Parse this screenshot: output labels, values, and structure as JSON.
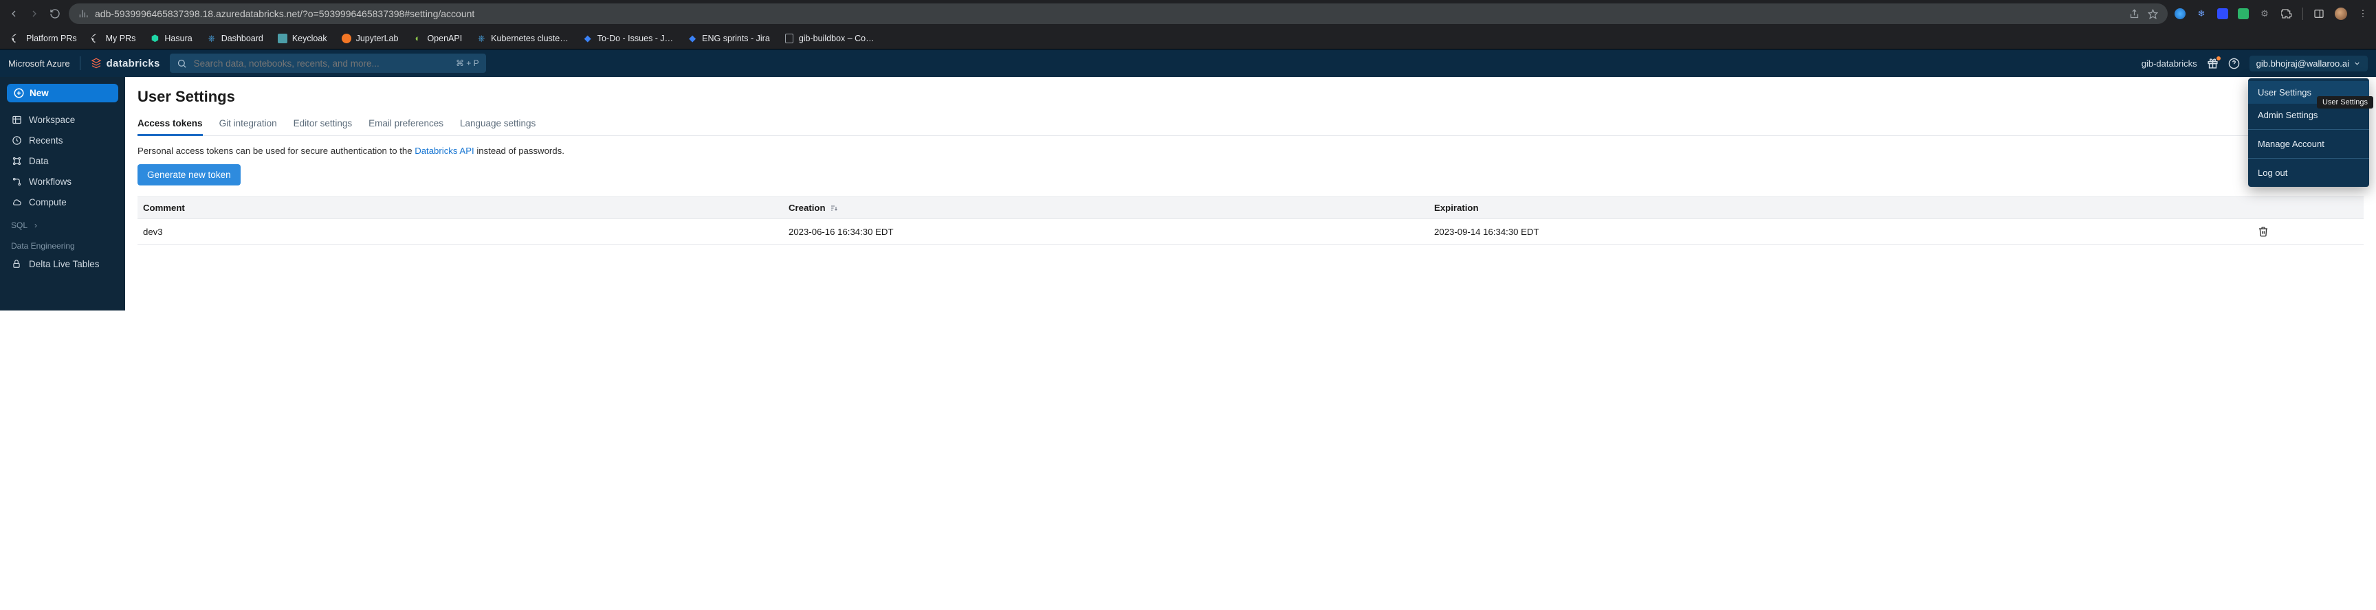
{
  "browser": {
    "url": "adb-5939996465837398.18.azuredatabricks.net/?o=5939996465837398#setting/account",
    "bookmarks": [
      {
        "label": "Platform PRs",
        "icon": "github"
      },
      {
        "label": "My PRs",
        "icon": "github"
      },
      {
        "label": "Hasura",
        "icon": "hasura"
      },
      {
        "label": "Dashboard",
        "icon": "k8s"
      },
      {
        "label": "Keycloak",
        "icon": "keycloak"
      },
      {
        "label": "JupyterLab",
        "icon": "jupyter"
      },
      {
        "label": "OpenAPI",
        "icon": "openapi"
      },
      {
        "label": "Kubernetes cluste…",
        "icon": "k8s"
      },
      {
        "label": "To-Do - Issues - J…",
        "icon": "jira"
      },
      {
        "label": "ENG sprints - Jira",
        "icon": "jira"
      },
      {
        "label": "gib-buildbox – Co…",
        "icon": "doc"
      }
    ]
  },
  "topbar": {
    "cloud": "Microsoft Azure",
    "brand": "databricks",
    "search_placeholder": "Search data, notebooks, recents, and more...",
    "search_shortcut": "⌘ + P",
    "workspace": "gib-databricks",
    "user_email": "gib.bhojraj@wallaroo.ai"
  },
  "sidebar": {
    "new_label": "New",
    "items": [
      {
        "label": "Workspace",
        "icon": "folder"
      },
      {
        "label": "Recents",
        "icon": "clock"
      },
      {
        "label": "Data",
        "icon": "data"
      },
      {
        "label": "Workflows",
        "icon": "flow"
      },
      {
        "label": "Compute",
        "icon": "cloud"
      }
    ],
    "sections": [
      {
        "label": "SQL",
        "chev": true
      },
      {
        "label": "Data Engineering"
      }
    ],
    "extra": [
      {
        "label": "Delta Live Tables",
        "icon": "lock"
      }
    ]
  },
  "page": {
    "title": "User Settings",
    "tabs": [
      "Access tokens",
      "Git integration",
      "Editor settings",
      "Email preferences",
      "Language settings"
    ],
    "active_tab": 0,
    "intro_pre": "Personal access tokens can be used for secure authentication to the ",
    "intro_link": "Databricks API",
    "intro_post": " instead of passwords.",
    "generate_button": "Generate new token",
    "columns": {
      "comment": "Comment",
      "creation": "Creation",
      "expiration": "Expiration"
    },
    "tokens": [
      {
        "comment": "dev3",
        "creation": "2023-06-16 16:34:30 EDT",
        "expiration": "2023-09-14 16:34:30 EDT"
      }
    ]
  },
  "user_menu": {
    "items": [
      "User Settings",
      "Admin Settings",
      "Manage Account",
      "Log out"
    ],
    "tooltip": "User Settings",
    "selected": 0
  }
}
